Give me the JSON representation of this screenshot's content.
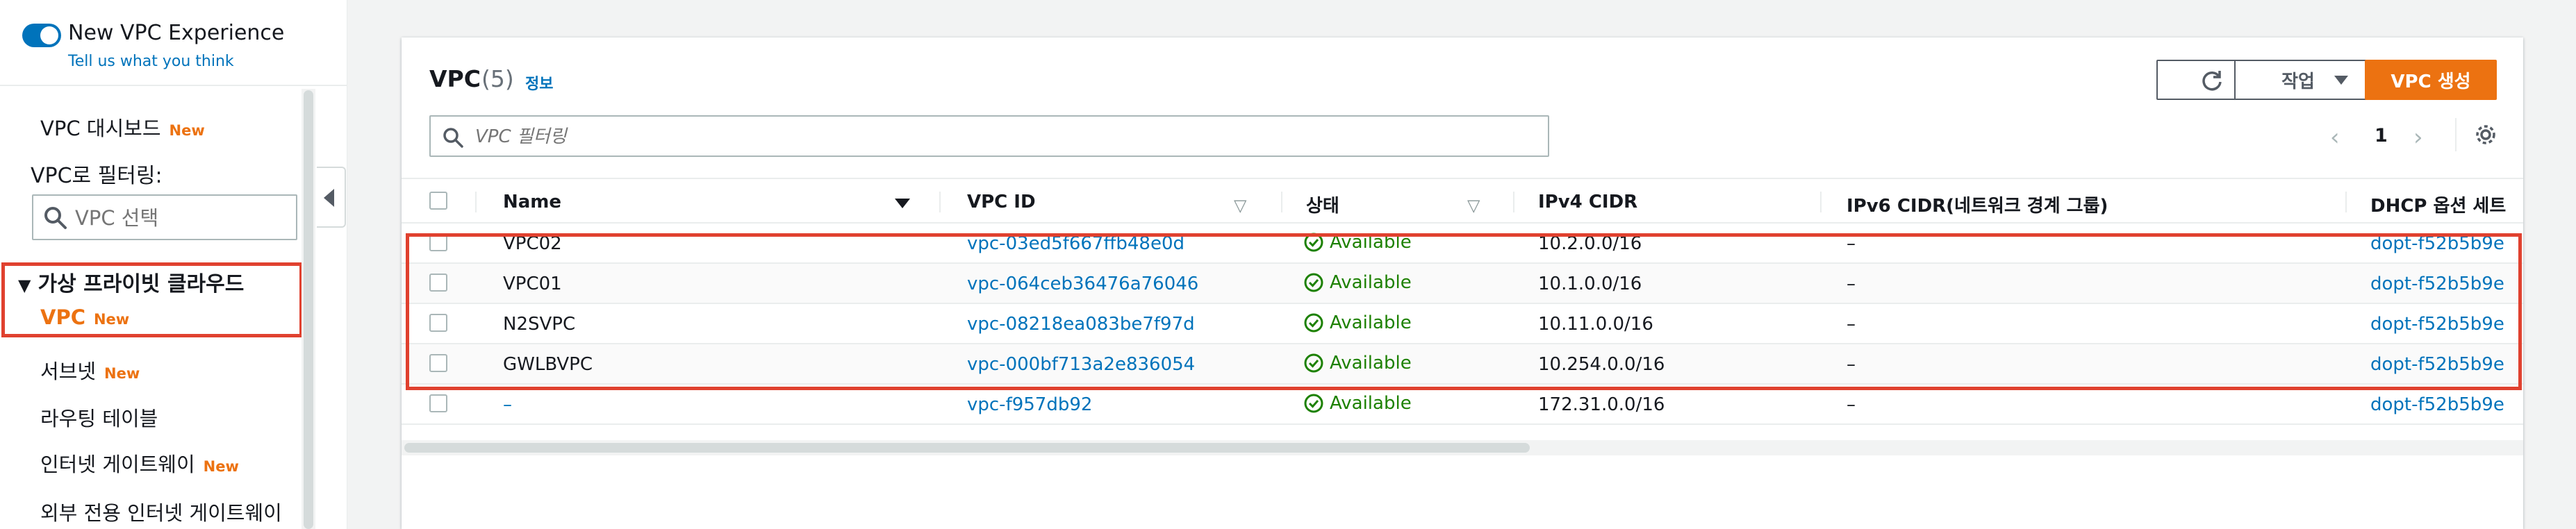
{
  "sidebar": {
    "experience_title": "New VPC Experience",
    "feedback_link": "Tell us what you think",
    "dashboard_label": "VPC 대시보드",
    "dashboard_badge": "New",
    "filter_label": "VPC로 필터링:",
    "filter_placeholder": "VPC 선택",
    "section_title": "가상 프라이빗 클라우드",
    "items": [
      {
        "label": "VPC",
        "badge": "New"
      },
      {
        "label": "서브넷",
        "badge": "New"
      },
      {
        "label": "라우팅 테이블",
        "badge": ""
      },
      {
        "label": "인터넷 게이트웨이",
        "badge": "New"
      },
      {
        "label": "외부 전용 인터넷 게이트웨이",
        "badge": ""
      }
    ]
  },
  "panel": {
    "title": "VPC",
    "count": "(5)",
    "info": "정보",
    "action_label": "작업",
    "create_label": "VPC 생성",
    "search_placeholder": "VPC 필터링",
    "page_number": "1"
  },
  "table": {
    "columns": [
      "Name",
      "VPC ID",
      "상태",
      "IPv4 CIDR",
      "IPv6 CIDR(네트워크 경계 그룹)",
      "DHCP 옵션 세트"
    ],
    "rows": [
      {
        "name": "VPC02",
        "vpc_id": "vpc-03ed5f667ffb48e0d",
        "status": "Available",
        "ipv4": "10.2.0.0/16",
        "ipv6": "–",
        "dhcp": "dopt-f52b5b9e"
      },
      {
        "name": "VPC01",
        "vpc_id": "vpc-064ceb36476a76046",
        "status": "Available",
        "ipv4": "10.1.0.0/16",
        "ipv6": "–",
        "dhcp": "dopt-f52b5b9e"
      },
      {
        "name": "N2SVPC",
        "vpc_id": "vpc-08218ea083be7f97d",
        "status": "Available",
        "ipv4": "10.11.0.0/16",
        "ipv6": "–",
        "dhcp": "dopt-f52b5b9e"
      },
      {
        "name": "GWLBVPC",
        "vpc_id": "vpc-000bf713a2e836054",
        "status": "Available",
        "ipv4": "10.254.0.0/16",
        "ipv6": "–",
        "dhcp": "dopt-f52b5b9e"
      },
      {
        "name": "–",
        "vpc_id": "vpc-f957db92",
        "status": "Available",
        "ipv4": "172.31.0.0/16",
        "ipv6": "–",
        "dhcp": "dopt-f52b5b9e"
      }
    ]
  },
  "colors": {
    "accent": "#ec7211",
    "link": "#0073bb",
    "success": "#1d8102",
    "highlight": "#e0412f"
  },
  "icons": [
    "toggle-switch",
    "search-icon",
    "refresh-icon",
    "caret-down-icon",
    "chevron-left-icon",
    "chevron-right-icon",
    "gear-icon",
    "check-circle-icon",
    "collapse-icon"
  ]
}
